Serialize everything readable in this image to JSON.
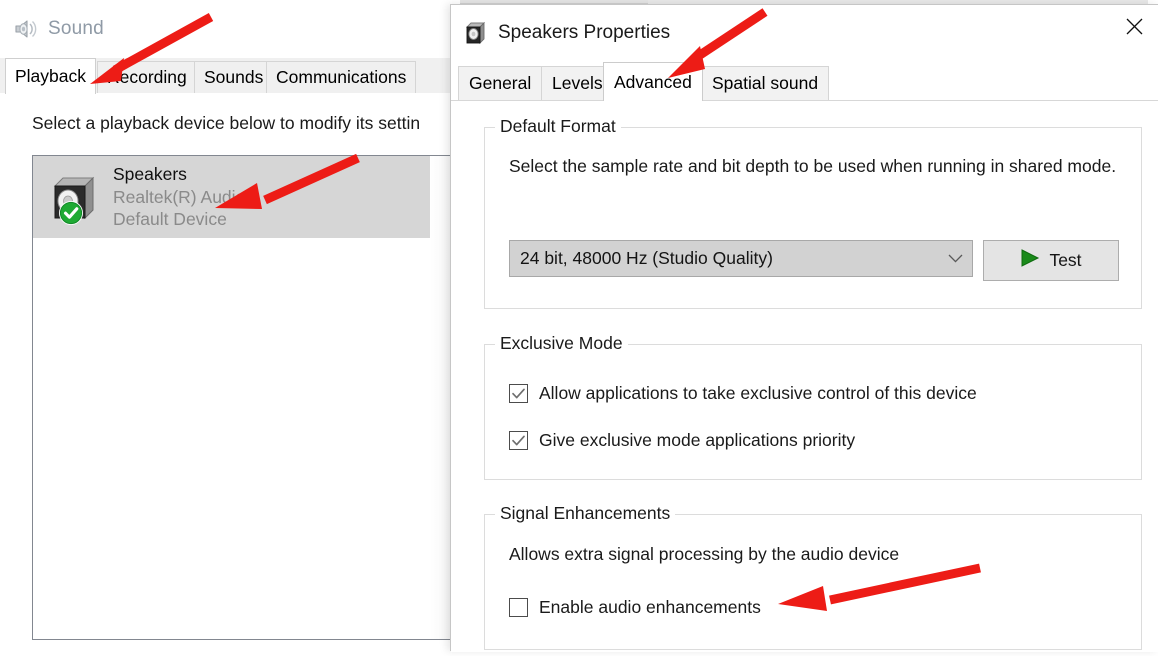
{
  "sound_window": {
    "title": "Sound",
    "title_icon": "speaker-icon",
    "tabs": [
      {
        "label": "Playback",
        "active": true
      },
      {
        "label": "Recording",
        "active": false
      },
      {
        "label": "Sounds",
        "active": false
      },
      {
        "label": "Communications",
        "active": false
      }
    ],
    "instruction": "Select a playback device below to modify its settin",
    "device": {
      "icon": "speaker-box-icon",
      "status_badge": "green-check-icon",
      "name": "Speakers",
      "driver": "Realtek(R) Audio",
      "status": "Default Device",
      "selected": true
    }
  },
  "properties_dialog": {
    "title": "Speakers Properties",
    "title_icon": "speaker-box-icon",
    "close_label": "✕",
    "tabs": [
      {
        "label": "General",
        "active": false
      },
      {
        "label": "Levels",
        "active": false
      },
      {
        "label": "Advanced",
        "active": true
      },
      {
        "label": "Spatial sound",
        "active": false
      }
    ],
    "default_format": {
      "legend": "Default Format",
      "description": "Select the sample rate and bit depth to be used when running in shared mode.",
      "combo_value": "24 bit, 48000 Hz (Studio Quality)",
      "combo_chevron_icon": "chevron-down-icon",
      "test_button_label": "Test",
      "test_button_icon": "play-triangle-icon"
    },
    "exclusive_mode": {
      "legend": "Exclusive Mode",
      "checkboxes": [
        {
          "label": "Allow applications to take exclusive control of this device",
          "checked": true
        },
        {
          "label": "Give exclusive mode applications priority",
          "checked": true
        }
      ]
    },
    "signal_enhancements": {
      "legend": "Signal Enhancements",
      "description": "Allows extra signal processing by the audio device",
      "checkboxes": [
        {
          "label": "Enable audio enhancements",
          "checked": false
        }
      ]
    }
  },
  "annotations": {
    "arrow_color": "#ED1C16",
    "arrows": [
      {
        "name": "arrow-to-playback-tab",
        "target": "Playback tab"
      },
      {
        "name": "arrow-to-device-row",
        "target": "Realtek(R) Audio device entry"
      },
      {
        "name": "arrow-to-advanced-tab",
        "target": "Advanced tab"
      },
      {
        "name": "arrow-to-enable-audio-enhancements",
        "target": "Enable audio enhancements checkbox"
      }
    ]
  },
  "colors": {
    "selection_gray": "#d6d6d6",
    "accent_green": "#1f8a1f",
    "arrow_red": "#ED1C16",
    "muted_text": "#8a8a8a"
  }
}
